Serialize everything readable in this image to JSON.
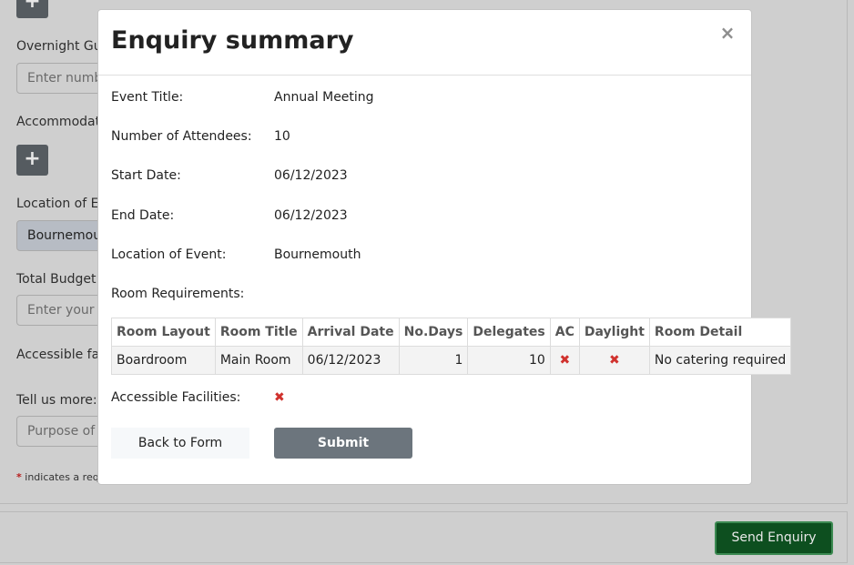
{
  "background_form": {
    "overnight_label": "Overnight Gu",
    "overnight_placeholder": "Enter numb",
    "accommodation_label": "Accommodat",
    "location_label": "Location of E",
    "location_value": "Bournemou",
    "budget_label": "Total Budget:",
    "budget_placeholder": "Enter your t",
    "accessible_label": "Accessible fa",
    "tell_us_label": "Tell us more: (",
    "purpose_placeholder": "Purpose of",
    "required_star": "*",
    "required_note": "indicates a req",
    "plus_symbol": "+",
    "send_button": "Send Enquiry"
  },
  "modal": {
    "title": "Enquiry summary",
    "close_symbol": "×",
    "fields": {
      "event_title_label": "Event Title:",
      "event_title_value": "Annual Meeting",
      "attendees_label": "Number of Attendees:",
      "attendees_value": "10",
      "start_date_label": "Start Date:",
      "start_date_value": "06/12/2023",
      "end_date_label": "End Date:",
      "end_date_value": "06/12/2023",
      "location_label": "Location of Event:",
      "location_value": "Bournemouth",
      "room_requirements_label": "Room Requirements:",
      "accessible_label": "Accessible Facilities:"
    },
    "rooms_table": {
      "headers": [
        "Room Layout",
        "Room Title",
        "Arrival Date",
        "No.Days",
        "Delegates",
        "AC",
        "Daylight",
        "Room Detail"
      ],
      "rows": [
        [
          "Boardroom",
          "Main Room",
          "06/12/2023",
          "1",
          "10",
          "✖",
          "✖",
          "No catering required"
        ]
      ]
    },
    "accessible_value": "✖",
    "back_button": "Back to Form",
    "submit_button": "Submit"
  },
  "colors": {
    "overlay": "#cfcfcf",
    "submit": "#6c757d",
    "send_enquiry": "#0d4f1f",
    "cross": "#d0312d"
  },
  "icons": {
    "close": "close-icon",
    "cross": "cross-icon",
    "plus": "plus-icon"
  }
}
